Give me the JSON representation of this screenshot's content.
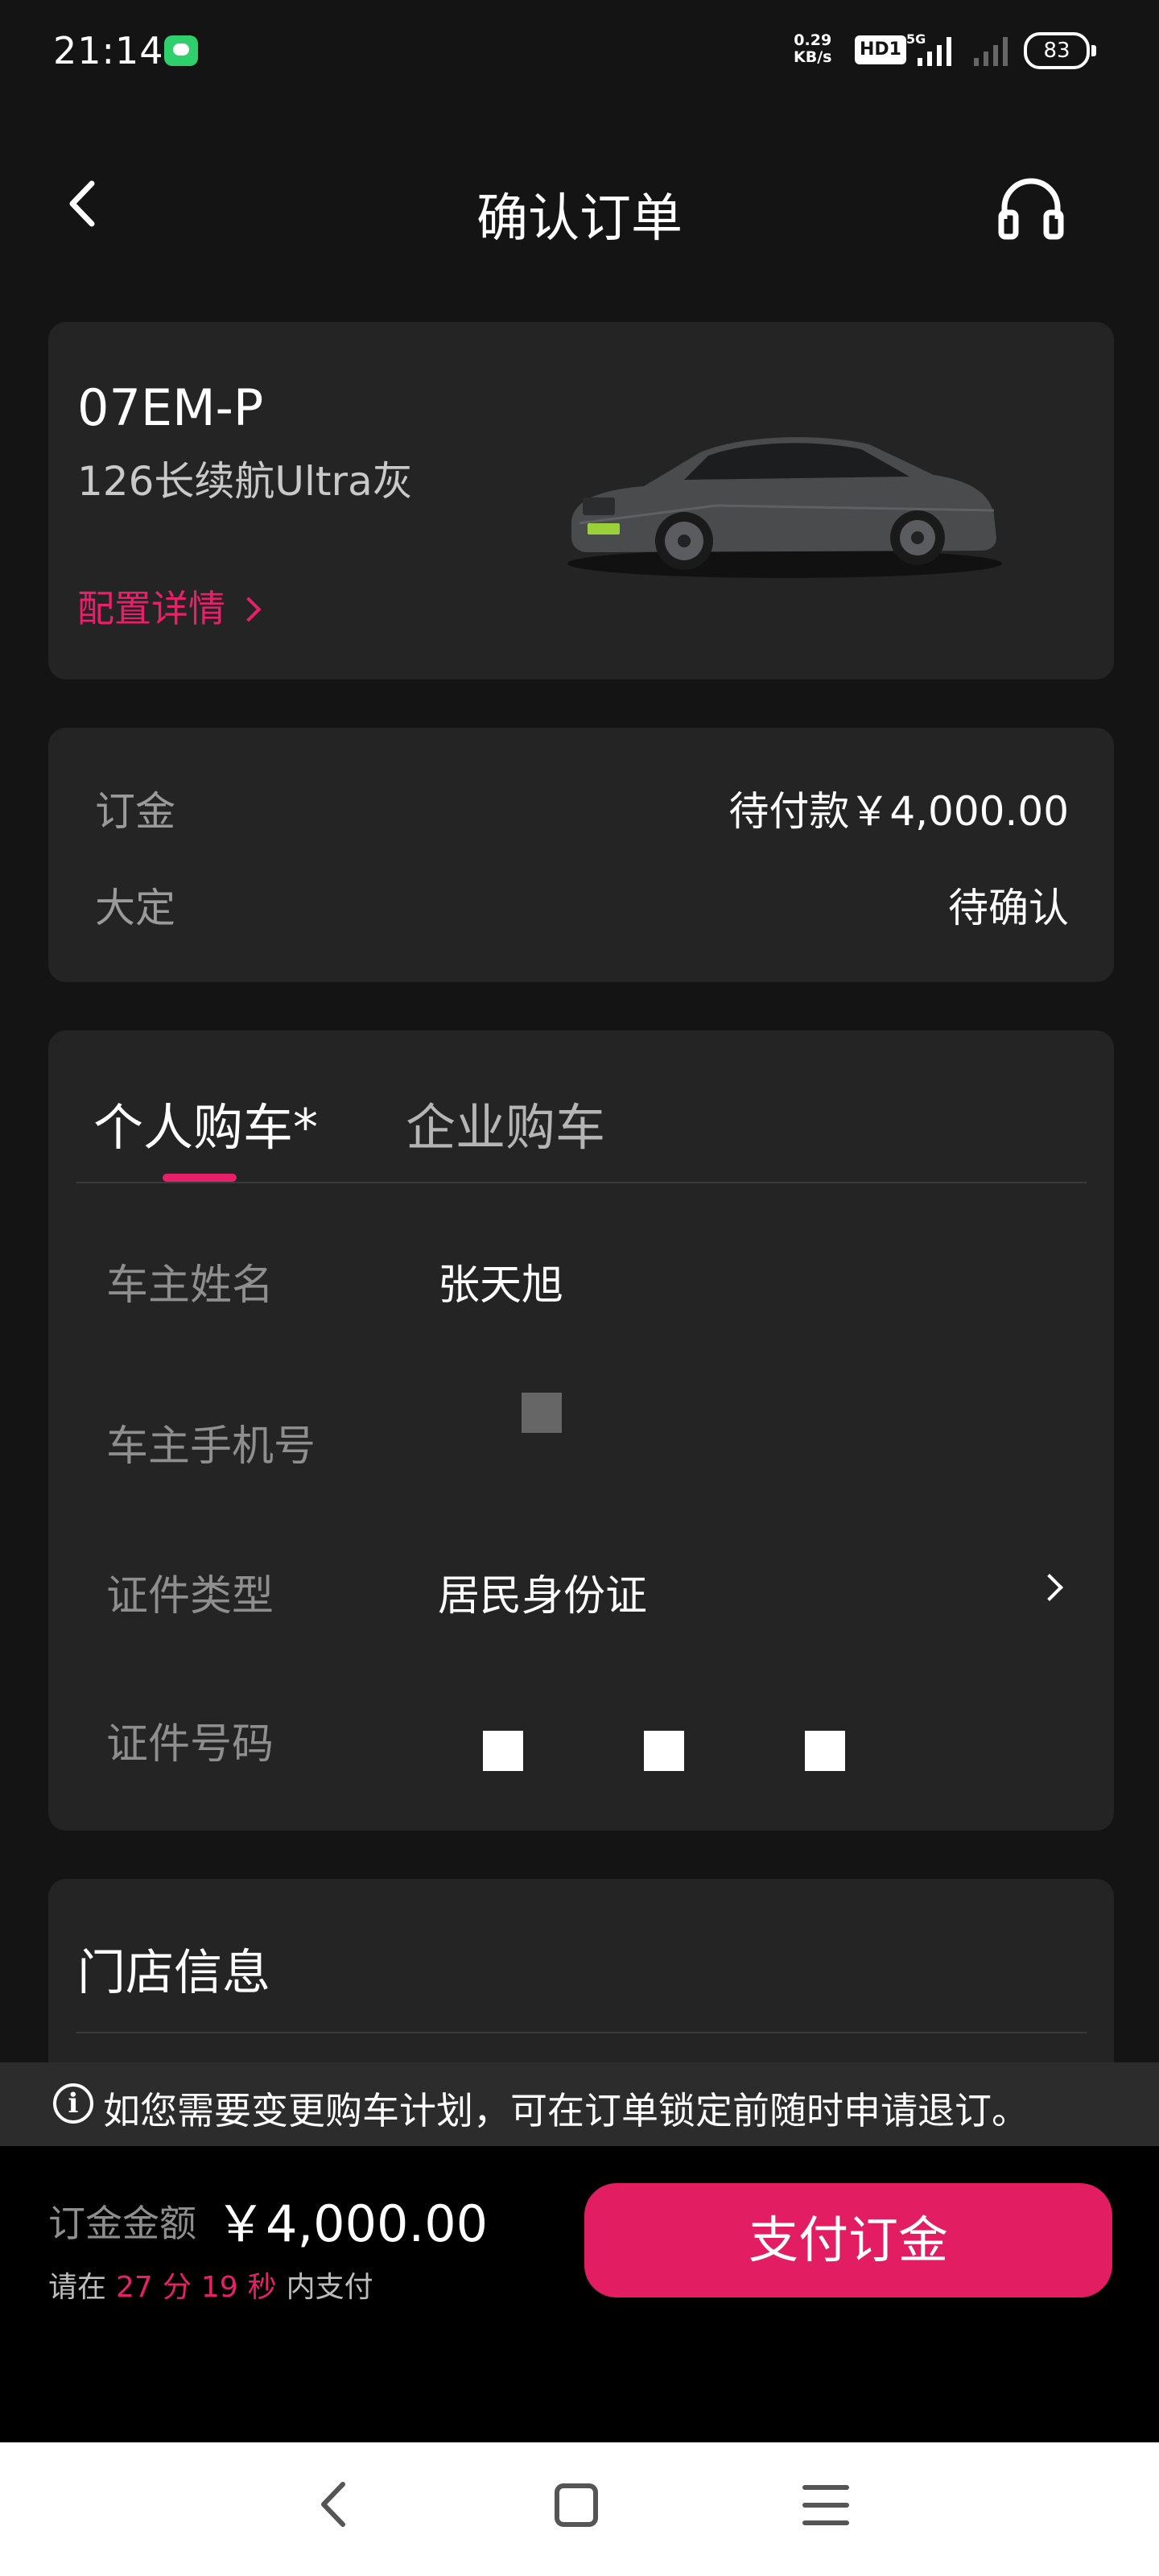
{
  "status_bar": {
    "time": "21:14",
    "net_speed_value": "0.29",
    "net_speed_unit": "KB/s",
    "hd_label": "HD1",
    "network": "5G",
    "battery": "83"
  },
  "header": {
    "title": "确认订单"
  },
  "car": {
    "model": "07EM-P",
    "variant": "126长续航Ultra灰",
    "config_link": "配置详情"
  },
  "payment": {
    "deposit_label": "订金",
    "deposit_value": "待付款￥4,000.00",
    "final_label": "大定",
    "final_value": "待确认"
  },
  "buyer": {
    "tabs": [
      {
        "label": "个人购车*",
        "active": true
      },
      {
        "label": "企业购车",
        "active": false
      }
    ],
    "fields": [
      {
        "label": "车主姓名",
        "value": "张天旭"
      },
      {
        "label": "车主手机号",
        "value": ""
      },
      {
        "label": "证件类型",
        "value": "居民身份证"
      },
      {
        "label": "证件号码",
        "value": ""
      }
    ]
  },
  "store": {
    "title": "门店信息"
  },
  "notice": {
    "text": "如您需要变更购车计划，可在订单锁定前随时申请退订。"
  },
  "pay_bar": {
    "amount_label": "订金金额",
    "amount_value": "￥4,000.00",
    "countdown_prefix": "请在",
    "minutes": "27",
    "minutes_unit": "分",
    "seconds": "19",
    "seconds_unit": "秒",
    "countdown_suffix": "内支付",
    "button_label": "支付订金"
  },
  "colors": {
    "background": "#141414",
    "card": "#242424",
    "accent": "#e8206a",
    "button": "#e31d62"
  }
}
